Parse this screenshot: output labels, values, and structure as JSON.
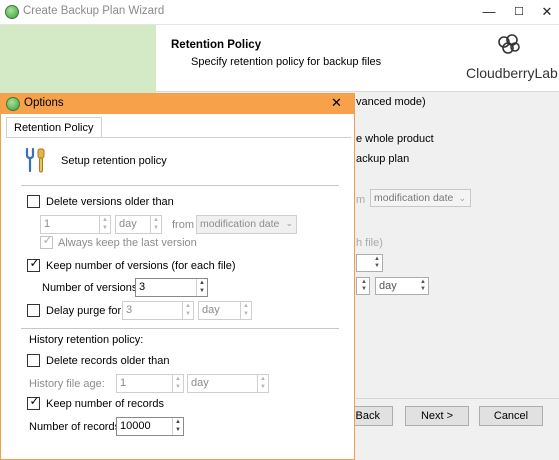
{
  "wizard": {
    "title": "Create Backup Plan Wizard",
    "header_title": "Retention Policy",
    "header_subtitle": "Specify retention policy for backup files",
    "logo_text": "CloudberryLab",
    "peek": {
      "advanced_mode": "vanced mode)",
      "whole_product": "e whole product",
      "backup_plan": "ackup plan",
      "from_label": "m",
      "from_value": "modification date",
      "each_file": "h file)",
      "day_value": "day"
    },
    "buttons": {
      "back": "Back",
      "next": "Next >",
      "cancel": "Cancel"
    }
  },
  "dialog": {
    "title": "Options",
    "tab": "Retention Policy",
    "setup_label": "Setup retention policy",
    "delete_versions": {
      "label": "Delete versions older than",
      "checked": false,
      "value": "1",
      "unit": "day",
      "from_label": "from",
      "from_value": "modification date"
    },
    "always_keep_last": {
      "label": "Always keep the last version",
      "checked": true
    },
    "keep_number": {
      "label": "Keep number of versions (for each file)",
      "checked": true
    },
    "number_of_versions": {
      "label": "Number of versions:",
      "value": "3"
    },
    "delay_purge": {
      "label": "Delay purge for:",
      "checked": false,
      "value": "3",
      "unit": "day"
    },
    "history": {
      "heading": "History retention policy:",
      "delete_records": {
        "label": "Delete records older than",
        "checked": false
      },
      "file_age": {
        "label": "History file age:",
        "value": "1",
        "unit": "day"
      },
      "keep_records": {
        "label": "Keep number of records",
        "checked": true
      },
      "number_of_records": {
        "label": "Number of records:",
        "value": "10000"
      }
    }
  }
}
